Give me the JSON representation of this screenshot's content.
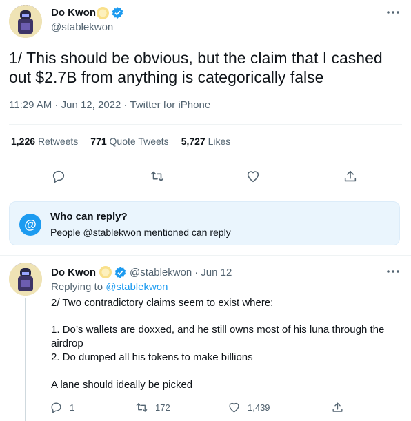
{
  "tweet": {
    "author_name": "Do Kwon",
    "author_handle": "@stablekwon",
    "text": "1/ This should be obvious, but the claim that I cashed out $2.7B from anything is categorically false",
    "time": "11:29 AM",
    "separator": "·",
    "date": "Jun 12, 2022",
    "source": "Twitter for iPhone",
    "stats": {
      "retweets_count": "1,226",
      "retweets_label": "Retweets",
      "quotes_count": "771",
      "quotes_label": "Quote Tweets",
      "likes_count": "5,727",
      "likes_label": "Likes"
    },
    "more_icon": "more-dots-icon"
  },
  "who_can_reply": {
    "title": "Who can reply?",
    "body": "People @stablekwon mentioned can reply",
    "icon_glyph": "@"
  },
  "reply": {
    "author_name": "Do Kwon",
    "author_handle": "@stablekwon",
    "separator": "·",
    "date": "Jun 12",
    "replying_to_label": "Replying to",
    "replying_to_handle": "@stablekwon",
    "line1": "2/ Two contradictory claims seem to exist where:",
    "line2": "1. Do’s wallets are doxxed, and he still owns most of his luna through the airdrop",
    "line3": "2. Do dumped all his tokens to make billions",
    "line4": "A lane should ideally be picked",
    "reply_count": "1",
    "retweet_count": "172",
    "like_count": "1,439"
  },
  "colors": {
    "accent": "#1d9bf0",
    "text": "#0f1419",
    "muted": "#536471",
    "info_bg": "#eaf5fd"
  }
}
